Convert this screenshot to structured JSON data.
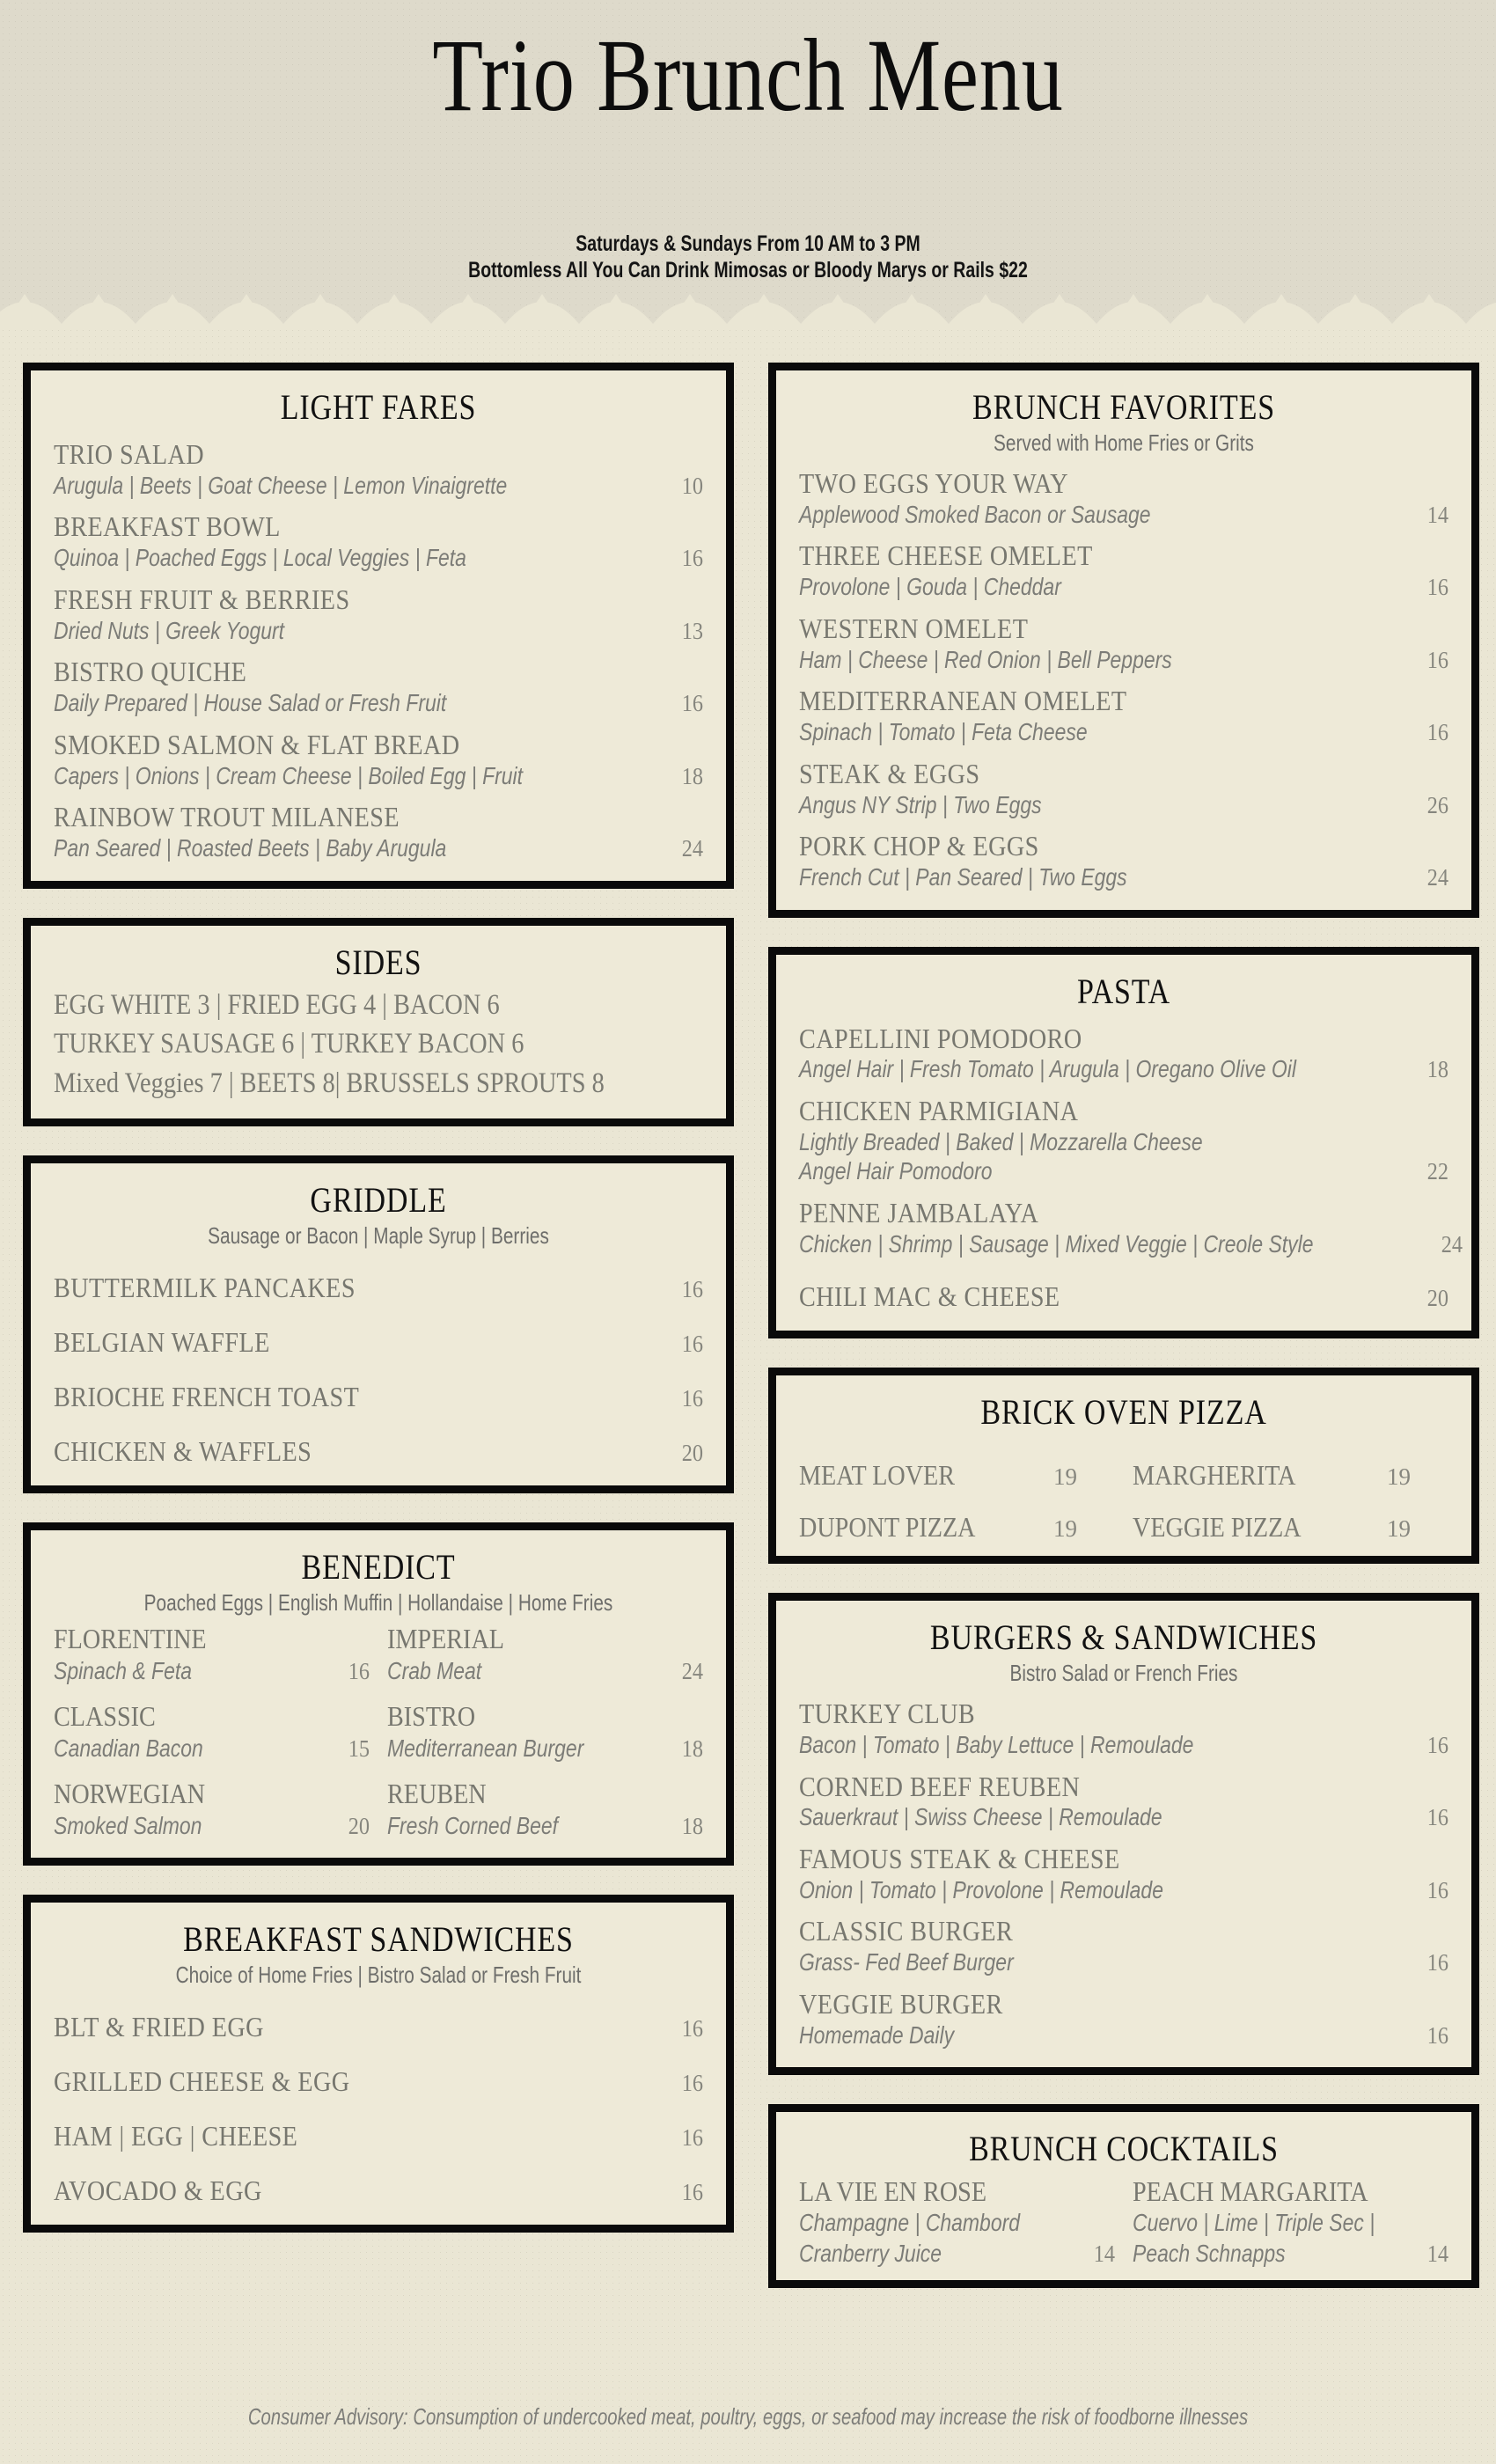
{
  "header": {
    "title": "Trio Brunch Menu",
    "hours": "Saturdays & Sundays From 10 AM to 3 PM",
    "bottomless": "Bottomless All You Can Drink  Mimosas or Bloody Marys or Rails  $22",
    "background_color": "#dedacb"
  },
  "page": {
    "background_color": "#eae6d4",
    "box_background": "#eeead8",
    "border_color": "#0a0a0a",
    "heading_color": "#111111",
    "item_color": "#77776f",
    "desc_color": "#7c7c77",
    "price_color": "#86867e"
  },
  "footer": {
    "advisory": "Consumer Advisory: Consumption of undercooked meat, poultry, eggs, or seafood may increase the risk of foodborne illnesses"
  },
  "sections": {
    "light_fares": {
      "title": "LIGHT  FARES",
      "items": [
        {
          "name": "TRIO SALAD",
          "desc": "Arugula | Beets | Goat Cheese | Lemon Vinaigrette",
          "price": "10"
        },
        {
          "name": "BREAKFAST BOWL",
          "desc": "Quinoa | Poached Eggs | Local Veggies | Feta",
          "price": "16"
        },
        {
          "name": "FRESH FRUIT & BERRIES",
          "desc": "Dried Nuts | Greek Yogurt",
          "price": "13"
        },
        {
          "name": "BISTRO QUICHE",
          "desc": "Daily Prepared | House Salad or Fresh Fruit",
          "price": "16"
        },
        {
          "name": "SMOKED SALMON & FLAT BREAD",
          "desc": "Capers | Onions | Cream Cheese | Boiled Egg | Fruit",
          "price": "18"
        },
        {
          "name": "RAINBOW TROUT MILANESE",
          "desc": "Pan Seared | Roasted Beets | Baby Arugula",
          "price": "24"
        }
      ]
    },
    "sides": {
      "title": "SIDES",
      "lines": [
        "EGG  WHITE  3  |  FRIED  EGG  4  |  BACON  6",
        "TURKEY SAUSAGE 6 | TURKEY BACON 6",
        "Mixed Veggies 7 | BEETS 8| BRUSSELS SPROUTS 8"
      ]
    },
    "griddle": {
      "title": "GRIDDLE",
      "subtitle": "Sausage or Bacon | Maple Syrup | Berries",
      "items": [
        {
          "name": "BUTTERMILK PANCAKES",
          "price": "16"
        },
        {
          "name": "BELGIAN WAFFLE",
          "price": "16"
        },
        {
          "name": "BRIOCHE FRENCH TOAST",
          "price": "16"
        },
        {
          "name": "CHICKEN & WAFFLES",
          "price": "20"
        }
      ]
    },
    "benedict": {
      "title": "BENEDICT",
      "subtitle": "Poached Eggs | English Muffin | Hollandaise | Home Fries",
      "items": [
        {
          "name": "FLORENTINE",
          "desc": "Spinach & Feta",
          "price": "16"
        },
        {
          "name": "IMPERIAL",
          "desc": "Crab Meat",
          "price": "24"
        },
        {
          "name": "CLASSIC",
          "desc": "Canadian Bacon",
          "price": "15"
        },
        {
          "name": "BISTRO",
          "desc": "Mediterranean Burger",
          "price": "18"
        },
        {
          "name": "NORWEGIAN",
          "desc": "Smoked Salmon",
          "price": "20"
        },
        {
          "name": "REUBEN",
          "desc": "Fresh  Corned Beef",
          "price": "18"
        }
      ]
    },
    "breakfast_sandwiches": {
      "title": "BREAKFAST SANDWICHES",
      "subtitle": "Choice of Home Fries | Bistro Salad or Fresh Fruit",
      "items": [
        {
          "name": "BLT & FRIED EGG",
          "price": "16"
        },
        {
          "name": "GRILLED CHEESE & EGG",
          "price": "16"
        },
        {
          "name": "HAM | EGG | CHEESE",
          "price": "16"
        },
        {
          "name": "AVOCADO  & EGG",
          "price": "16"
        }
      ]
    },
    "brunch_favorites": {
      "title": "BRUNCH FAVORITES",
      "subtitle": "Served with Home Fries or Grits",
      "items": [
        {
          "name": "TWO EGGS YOUR WAY",
          "desc": "Applewood Smoked Bacon or Sausage",
          "price": "14"
        },
        {
          "name": "THREE CHEESE OMELET",
          "desc": "Provolone | Gouda | Cheddar",
          "price": "16"
        },
        {
          "name": "WESTERN OMELET",
          "desc": "Ham | Cheese | Red Onion | Bell Peppers",
          "price": "16"
        },
        {
          "name": "MEDITERRANEAN OMELET",
          "desc": "Spinach | Tomato | Feta Cheese",
          "price": "16"
        },
        {
          "name": "STEAK & EGGS",
          "desc": "Angus NY Strip | Two Eggs",
          "price": "26"
        },
        {
          "name": "PORK CHOP & EGGS",
          "desc": "French Cut | Pan Seared | Two Eggs",
          "price": "24"
        }
      ]
    },
    "pasta": {
      "title": "PASTA",
      "items": [
        {
          "name": "CAPELLINI POMODORO",
          "desc": "Angel Hair | Fresh Tomato | Arugula | Oregano Olive Oil",
          "price": "18"
        },
        {
          "name": "CHICKEN PARMIGIANA",
          "desc": "Lightly Breaded | Baked | Mozzarella Cheese",
          "desc2": "Angel Hair Pomodoro",
          "price": "22"
        },
        {
          "name": "PENNE JAMBALAYA",
          "desc": "Chicken | Shrimp | Sausage | Mixed Veggie | Creole Style",
          "price": "24"
        },
        {
          "name": "CHILI MAC & CHEESE",
          "desc": "",
          "price": "20"
        }
      ]
    },
    "brick_oven_pizza": {
      "title": "BRICK OVEN PIZZA",
      "items": [
        {
          "name": "MEAT LOVER",
          "price": "19"
        },
        {
          "name": "MARGHERITA",
          "price": "19"
        },
        {
          "name": "DUPONT PIZZA",
          "price": "19"
        },
        {
          "name": "VEGGIE PIZZA",
          "price": "19"
        }
      ]
    },
    "burgers_sandwiches": {
      "title": "BURGERS & SANDWICHES",
      "subtitle": "Bistro Salad or French Fries",
      "items": [
        {
          "name": "TURKEY CLUB",
          "desc": "Bacon | Tomato | Baby Lettuce | Remoulade",
          "price": "16"
        },
        {
          "name": "CORNED BEEF REUBEN",
          "desc": "Sauerkraut | Swiss Cheese | Remoulade",
          "price": "16"
        },
        {
          "name": "FAMOUS STEAK & CHEESE",
          "desc": "Onion | Tomato | Provolone | Remoulade",
          "price": "16"
        },
        {
          "name": "CLASSIC BURGER",
          "desc": "Grass- Fed Beef Burger",
          "price": "16"
        },
        {
          "name": "VEGGIE BURGER",
          "desc": "Homemade Daily",
          "price": "16"
        }
      ]
    },
    "brunch_cocktails": {
      "title": "BRUNCH COCKTAILS",
      "items": [
        {
          "name": "LA VIE EN ROSE",
          "desc": "Champagne | Chambord",
          "desc2": "Cranberry Juice",
          "price": "14"
        },
        {
          "name": "PEACH MARGARITA",
          "desc": "Cuervo | Lime | Triple Sec |",
          "desc2": "Peach Schnapps",
          "price": "14"
        }
      ]
    }
  }
}
